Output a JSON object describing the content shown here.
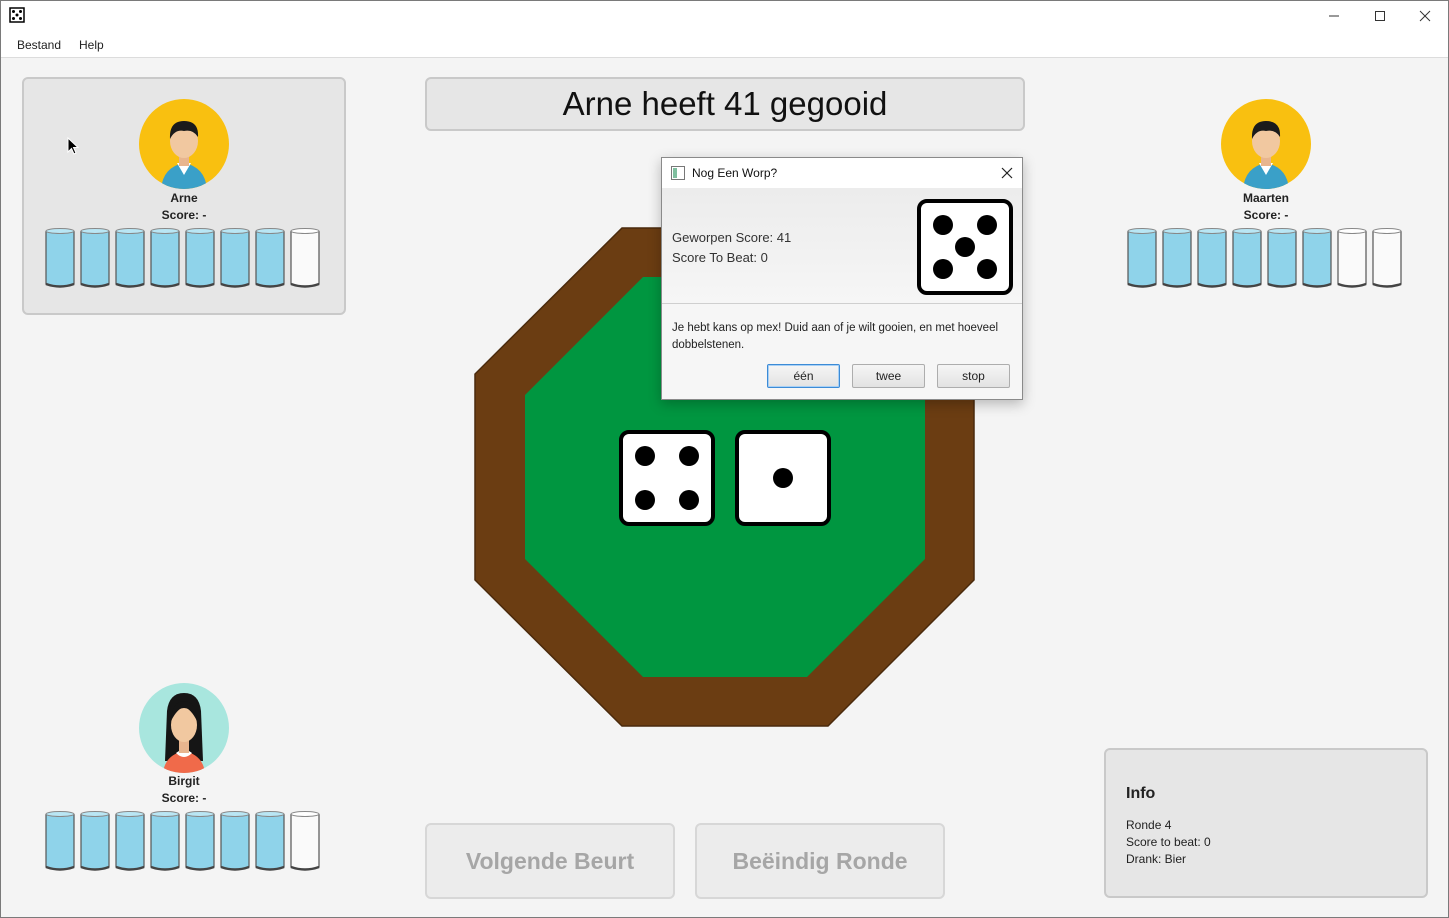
{
  "menu": {
    "items": [
      "Bestand",
      "Help"
    ]
  },
  "status_text": "Arne heeft 41 gegooid",
  "players": [
    {
      "name": "Arne",
      "score": "Score: -",
      "glasses_full": 7,
      "glasses_total": 8,
      "avatar": "male-avatar-icon",
      "avatar_bg": "#f9c010",
      "active": true
    },
    {
      "name": "Maarten",
      "score": "Score: -",
      "glasses_full": 6,
      "glasses_total": 8,
      "avatar": "male-avatar-icon",
      "avatar_bg": "#f9c010",
      "active": false
    },
    {
      "name": "Birgit",
      "score": "Score: -",
      "glasses_full": 7,
      "glasses_total": 8,
      "avatar": "female-avatar-icon",
      "avatar_bg": "#a8e6de",
      "active": false
    }
  ],
  "table": {
    "dice": [
      4,
      1
    ],
    "felt_color": "#009640",
    "rim_color": "#6b3d12"
  },
  "buttons": {
    "next_turn": "Volgende Beurt",
    "end_round": "Beëindig Ronde"
  },
  "info": {
    "title": "Info",
    "round": "Ronde 4",
    "score_to_beat": "Score to beat: 0",
    "drink": "Drank: Bier"
  },
  "dialog": {
    "title": "Nog Een Worp?",
    "thrown_score": "Geworpen Score: 41",
    "score_to_beat": "Score To Beat: 0",
    "die_value": 5,
    "message": "Je hebt kans op mex! Duid aan of je wilt gooien, en met hoeveel dobbelstenen.",
    "buttons": [
      "één",
      "twee",
      "stop"
    ]
  },
  "colors": {
    "water": "#8fd3ea",
    "glass_rim": "#555555"
  }
}
